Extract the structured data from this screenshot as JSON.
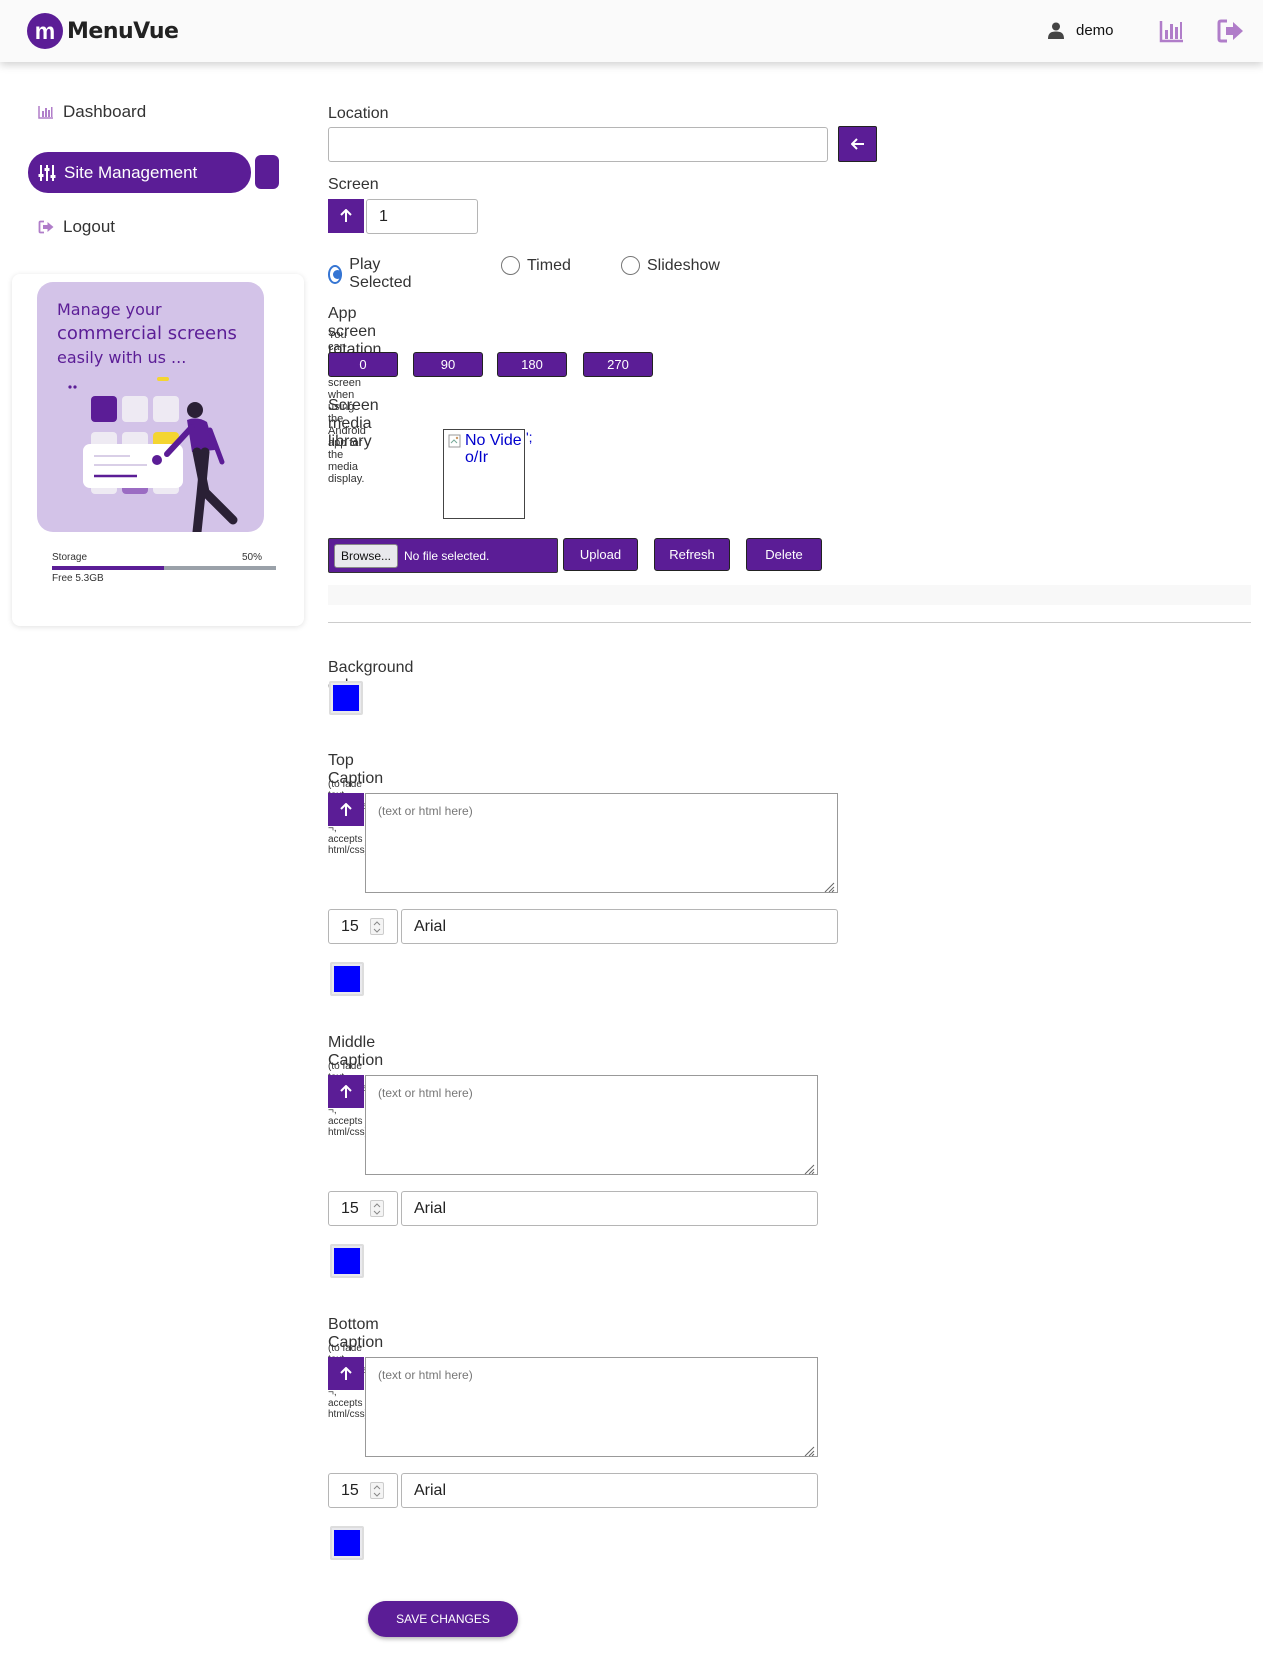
{
  "header": {
    "brand_letter": "m",
    "brand_name": "MenuVue",
    "username": "demo",
    "colors": {
      "brand": "#5b1d96",
      "accent_icon": "#b07dc9"
    }
  },
  "sidebar": {
    "items": [
      {
        "label": "Dashboard",
        "icon": "chart-bar-icon"
      },
      {
        "label": "Site Management",
        "icon": "sliders-icon"
      },
      {
        "label": "Logout",
        "icon": "sign-out-icon"
      }
    ],
    "promo": {
      "line1": "Manage your",
      "line2": "commercial screens",
      "line3": "easily with us ..."
    },
    "storage": {
      "label": "Storage",
      "percent_text": "50%",
      "percent": 50,
      "free": "Free 5.3GB"
    }
  },
  "form": {
    "location": {
      "label": "Location",
      "value": ""
    },
    "screen": {
      "label": "Screen",
      "value": "1"
    },
    "play_modes": [
      {
        "label": "Play Selected",
        "selected": true
      },
      {
        "label": "Timed",
        "selected": false
      },
      {
        "label": "Slideshow",
        "selected": false
      }
    ],
    "rotation": {
      "label": "App screen rotation",
      "hint": "You can rotate the screen when using the Android app for the media display.",
      "options": [
        "0",
        "90",
        "180",
        "270"
      ]
    },
    "media_library": {
      "label": "Screen media library",
      "placeholder_alt": "No Video/Ir",
      "quote_glyph": "';"
    },
    "upload": {
      "browse_label": "Browse...",
      "file_status": "No file selected.",
      "upload_label": "Upload",
      "refresh_label": "Refresh",
      "delete_label": "Delete"
    },
    "background_color": {
      "label": "Background color",
      "value": "#0000ff"
    },
    "captions": [
      {
        "label": "Top Caption",
        "hint": "(to fade text seperate line by ¬, accepts html/css)",
        "placeholder": "(text or html here)",
        "font_size": "15",
        "font_family": "Arial",
        "color": "#0000ff"
      },
      {
        "label": "Middle Caption",
        "hint": "(to fade text seperate line by ¬, accepts html/css)",
        "placeholder": "(text or html here)",
        "font_size": "15",
        "font_family": "Arial",
        "color": "#0000ff"
      },
      {
        "label": "Bottom Caption",
        "hint": "(to fade text seperate line by ¬, accepts html/css)",
        "placeholder": "(text or html here)",
        "font_size": "15",
        "font_family": "Arial",
        "color": "#0000ff"
      }
    ],
    "save_label": "SAVE CHANGES"
  }
}
